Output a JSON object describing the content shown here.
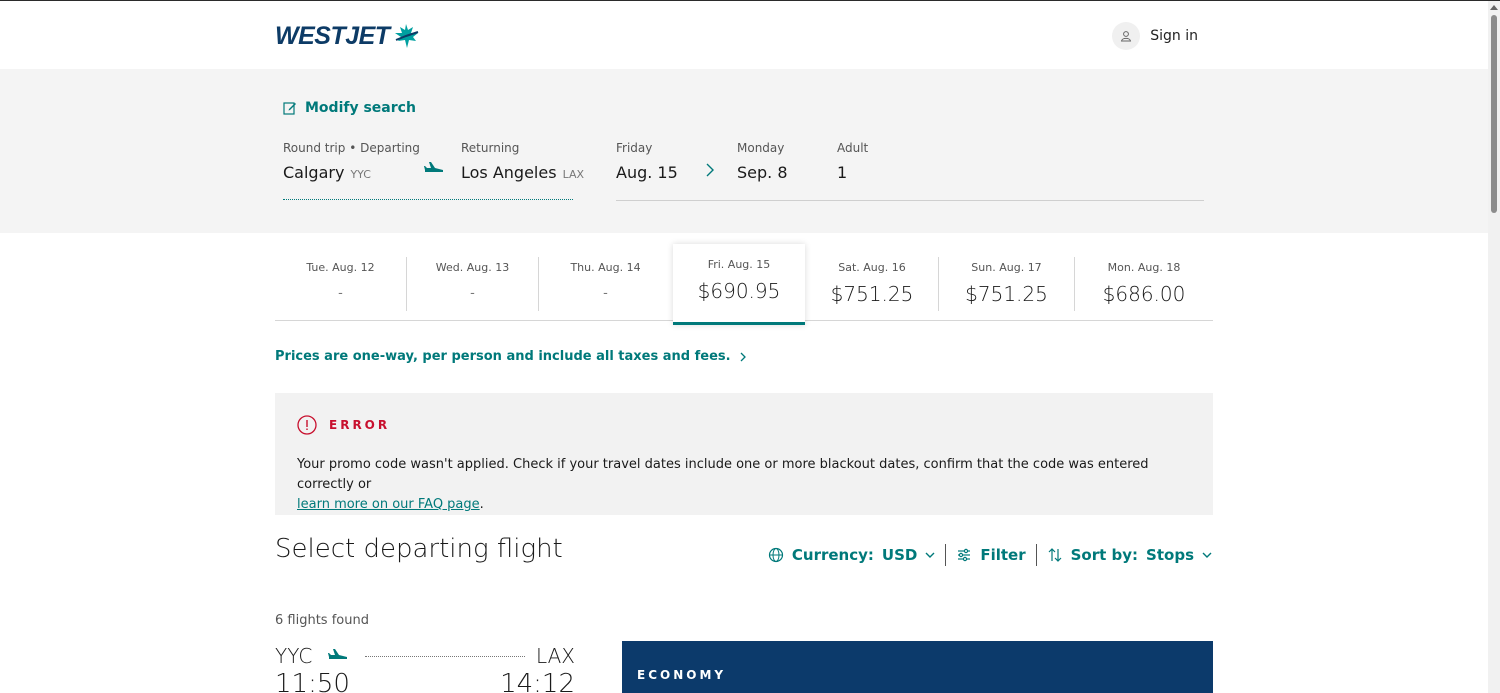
{
  "header": {
    "logo": "WESTJET",
    "sign_in": "Sign in"
  },
  "search": {
    "modify_label": "Modify search",
    "trip_type": "Round trip",
    "departing_label": "Departing",
    "origin_city": "Calgary",
    "origin_code": "YYC",
    "returning_label": "Returning",
    "dest_city": "Los Angeles",
    "dest_code": "LAX",
    "depart_day": "Friday",
    "depart_date": "Aug. 15",
    "return_day": "Monday",
    "return_date": "Sep. 8",
    "pax_label": "Adult",
    "pax_count": "1"
  },
  "dates": [
    {
      "label": "Tue. Aug. 12",
      "price": "-"
    },
    {
      "label": "Wed. Aug. 13",
      "price": "-"
    },
    {
      "label": "Thu. Aug. 14",
      "price": "-"
    },
    {
      "label": "Fri. Aug. 15",
      "price": "$690.95",
      "selected": true
    },
    {
      "label": "Sat. Aug. 16",
      "price": "$751.25"
    },
    {
      "label": "Sun. Aug. 17",
      "price": "$751.25"
    },
    {
      "label": "Mon. Aug. 18",
      "price": "$686.00"
    }
  ],
  "prices_note": "Prices are one-way, per person and include all taxes and fees.",
  "error": {
    "title": "ERROR",
    "message": "Your promo code wasn't applied. Check if your travel dates include one or more blackout dates, confirm that the code was entered correctly or ",
    "link": "learn more on our FAQ page",
    "after": "."
  },
  "results": {
    "title": "Select departing flight",
    "currency_label": "Currency:",
    "currency_value": "USD",
    "filter_label": "Filter",
    "sort_label": "Sort by:",
    "sort_value": "Stops",
    "count": "6 flights found",
    "flight": {
      "from": "YYC",
      "to": "LAX",
      "depart_time": "11:50",
      "arrive_time": "14:12"
    },
    "cabin": "ECONOMY"
  },
  "colors": {
    "teal": "#00797a",
    "navy": "#0c3a6b",
    "error_red": "#c8102e"
  }
}
